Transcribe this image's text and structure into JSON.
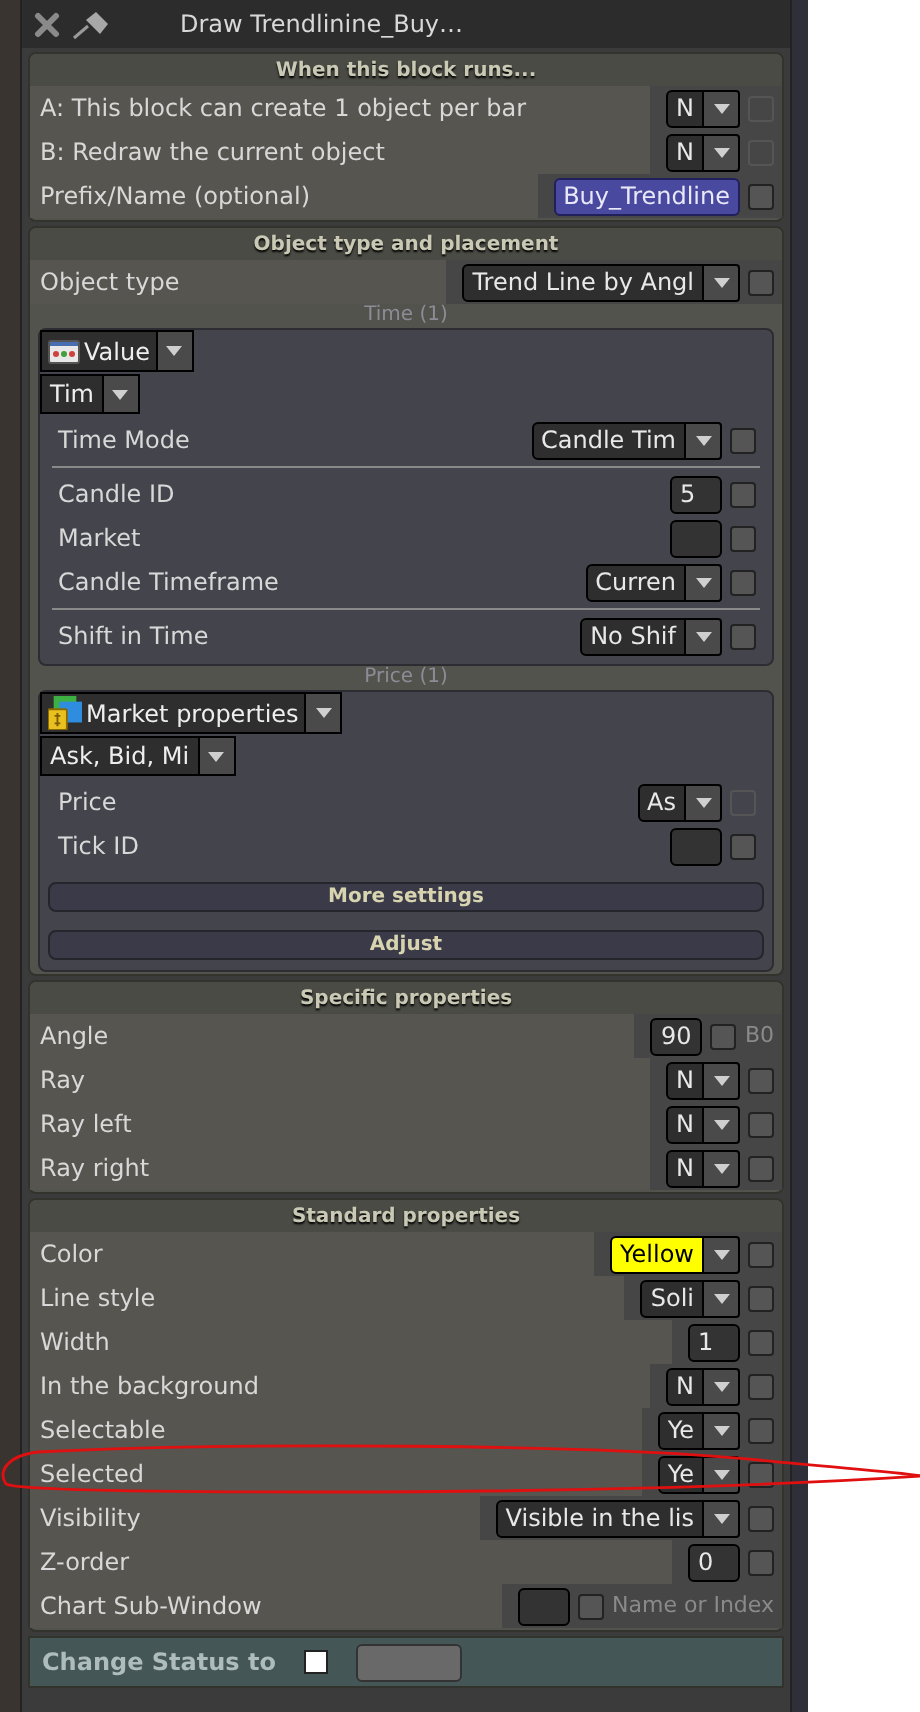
{
  "window": {
    "title": "Draw Trendlinine_Buy…"
  },
  "sections": [
    {
      "title": "When this block runs...",
      "items": [
        {
          "kind": "dropdown",
          "label": "A: This block can create 1 object per bar",
          "value": "N",
          "checked": false,
          "disabled": true
        },
        {
          "kind": "dropdown",
          "label": "B: Redraw the current object",
          "value": "N",
          "checked": false,
          "disabled": true
        },
        {
          "kind": "name",
          "label": "Prefix/Name (optional)",
          "value": "Buy_Trendline",
          "checked": false,
          "disabled": false
        }
      ]
    },
    {
      "title": "Object type and placement",
      "items": [
        {
          "kind": "dropdown",
          "label": "Object type",
          "value": "Trend Line by Angl",
          "checked": false,
          "disabled": false
        },
        {
          "kind": "subpanel",
          "title": "Time (1)",
          "source": {
            "kind": "value",
            "value": "Value"
          },
          "mode": "Tim",
          "rows": [
            {
              "kind": "dropdown",
              "label": "Time Mode",
              "value": "Candle Tim",
              "checked": false,
              "disabled": false
            },
            {
              "kind": "divider"
            },
            {
              "kind": "number",
              "label": "Candle ID",
              "value": "5",
              "checked": false,
              "disabled": false
            },
            {
              "kind": "number",
              "label": "Market",
              "checked": false,
              "disabled": false
            },
            {
              "kind": "dropdown",
              "label": "Candle Timeframe",
              "value": "Curren",
              "checked": false,
              "disabled": false
            },
            {
              "kind": "divider"
            },
            {
              "kind": "dropdown",
              "label": "Shift in Time",
              "value": "No Shif",
              "checked": false,
              "disabled": false
            }
          ]
        },
        {
          "kind": "subpanel",
          "title": "Price (1)",
          "source": {
            "kind": "market",
            "value": "Market properties"
          },
          "mode": "Ask, Bid, Mi",
          "rows": [
            {
              "kind": "dropdown",
              "label": "Price",
              "value": "As",
              "checked": false,
              "disabled": true
            },
            {
              "kind": "number",
              "label": "Tick ID",
              "checked": false,
              "disabled": false
            }
          ],
          "buttons": [
            "More settings",
            "Adjust"
          ]
        }
      ]
    },
    {
      "title": "Specific properties",
      "items": [
        {
          "kind": "number",
          "label": "Angle",
          "value": "90",
          "note": "B0",
          "checked": false,
          "disabled": false
        },
        {
          "kind": "dropdown",
          "label": "Ray",
          "value": "N",
          "checked": false,
          "disabled": false
        },
        {
          "kind": "dropdown",
          "label": "Ray left",
          "value": "N",
          "checked": false,
          "disabled": false
        },
        {
          "kind": "dropdown",
          "label": "Ray right",
          "value": "N",
          "checked": false,
          "disabled": false
        }
      ]
    },
    {
      "title": "Standard properties",
      "items": [
        {
          "kind": "dropdown",
          "label": "Color",
          "value": "Yellow",
          "color": "#ffff00",
          "checked": false,
          "disabled": false
        },
        {
          "kind": "dropdown",
          "label": "Line style",
          "value": "Soli",
          "checked": false,
          "disabled": false
        },
        {
          "kind": "number",
          "label": "Width",
          "value": "1",
          "checked": false,
          "disabled": false
        },
        {
          "kind": "dropdown",
          "label": "In the background",
          "value": "N",
          "checked": false,
          "disabled": false
        },
        {
          "kind": "dropdown",
          "label": "Selectable",
          "value": "Ye",
          "checked": false,
          "disabled": false
        },
        {
          "kind": "dropdown",
          "label": "Selected",
          "value": "Ye",
          "circled": true,
          "checked": false,
          "disabled": false
        },
        {
          "kind": "dropdown",
          "label": "Visibility",
          "value": "Visible in the lis",
          "checked": false,
          "disabled": false
        },
        {
          "kind": "number",
          "label": "Z-order",
          "value": "0",
          "checked": false,
          "disabled": false
        },
        {
          "kind": "number",
          "label": "Chart Sub-Window",
          "note": "Name or Index",
          "checked": false,
          "disabled": false
        }
      ]
    }
  ],
  "status": {
    "label": "Change Status to",
    "checked": false
  }
}
